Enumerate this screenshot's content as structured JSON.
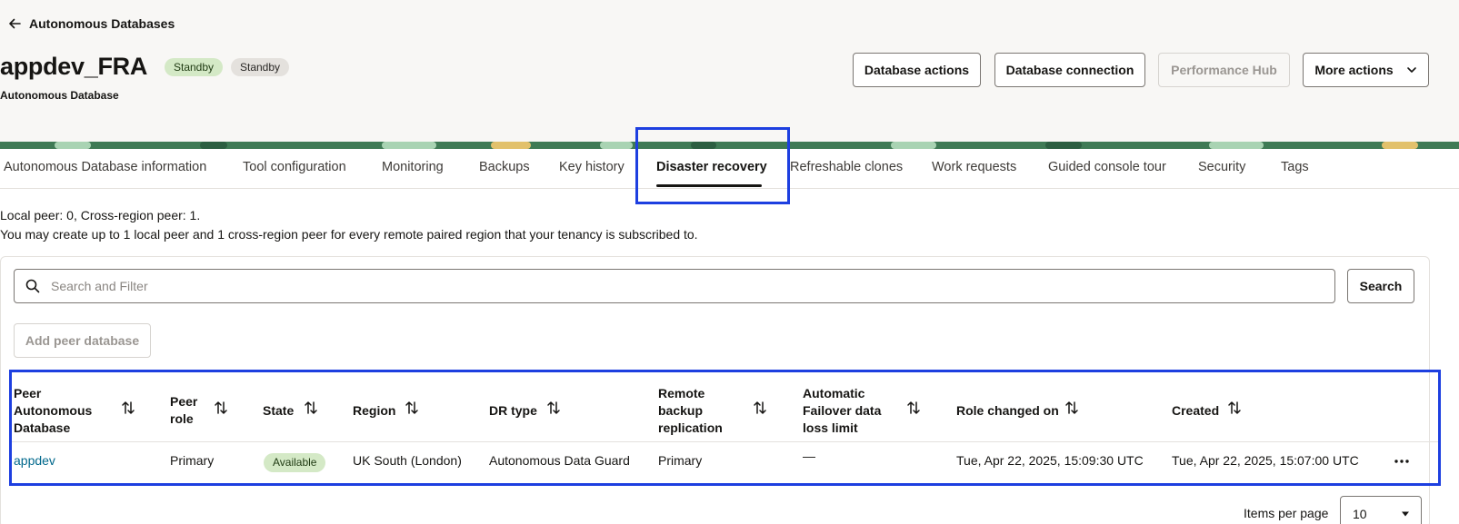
{
  "header": {
    "back_label": "Autonomous Databases",
    "title": "appdev_FRA",
    "badges": [
      "Standby",
      "Standby"
    ],
    "subtitle": "Autonomous Database",
    "actions": {
      "database_actions": "Database actions",
      "database_connection": "Database connection",
      "performance_hub": "Performance Hub",
      "more_actions": "More actions"
    }
  },
  "tabs": [
    "Autonomous Database information",
    "Tool configuration",
    "Monitoring",
    "Backups",
    "Key history",
    "Disaster recovery",
    "Refreshable clones",
    "Work requests",
    "Guided console tour",
    "Security",
    "Tags"
  ],
  "active_tab": "Disaster recovery",
  "info": {
    "line1": "Local peer: 0, Cross-region peer: 1.",
    "line2": "You may create up to 1 local peer and 1 cross-region peer for every remote paired region that your tenancy is subscribed to."
  },
  "search": {
    "placeholder": "Search and Filter",
    "button": "Search"
  },
  "add_peer_label": "Add peer database",
  "table": {
    "columns": [
      "Peer Autonomous Database",
      "Peer role",
      "State",
      "Region",
      "DR type",
      "Remote backup replication",
      "Automatic Failover data loss limit",
      "Role changed on",
      "Created"
    ],
    "rows": [
      {
        "peer": "appdev",
        "role": "Primary",
        "state": "Available",
        "region": "UK South (London)",
        "dr_type": "Autonomous Data Guard",
        "remote_backup": "Primary",
        "failover_limit": "—",
        "role_changed_on": "Tue, Apr 22, 2025, 15:09:30 UTC",
        "created": "Tue, Apr 22, 2025, 15:07:00 UTC"
      }
    ]
  },
  "pagination": {
    "items_per_page_label": "Items per page",
    "items_per_page": "10"
  },
  "colors": {
    "accent_link": "#00688c",
    "highlight": "#1d3fe0",
    "available_badge": "#d4e9c6",
    "banner": "#3f7a55"
  }
}
